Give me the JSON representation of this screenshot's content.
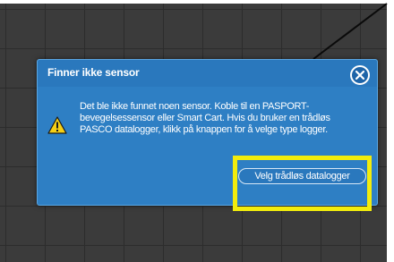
{
  "dialog": {
    "title": "Finner ikke sensor",
    "message": "Det ble ikke funnet noen sensor. Koble til en PASPORT-bevegelsessensor eller Smart Cart. Hvis du bruker en trådløs PASCO datalogger, klikk på knappen for å velge type logger.",
    "button_label": "Velg trådløs datalogger",
    "close_icon": "close-icon",
    "warning_icon": "warning-icon"
  },
  "colors": {
    "dialog_background": "#2e7fc4",
    "highlight": "#f2ec0c",
    "warning": "#f5d016",
    "graph_background": "#3b3b3b"
  }
}
